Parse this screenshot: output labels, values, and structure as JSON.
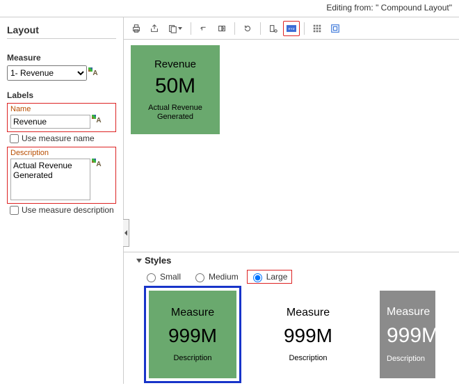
{
  "header": {
    "editing_from_label": "Editing from:",
    "editing_from_value": "\" Compound Layout\""
  },
  "sidebar": {
    "title": "Layout",
    "measure_label": "Measure",
    "measure_value": "1- Revenue",
    "labels_label": "Labels",
    "name_box": {
      "title": "Name",
      "value": "Revenue"
    },
    "use_measure_name": "Use measure name",
    "description_box": {
      "title": "Description",
      "value": "Actual Revenue Generated"
    },
    "use_measure_description": "Use measure description"
  },
  "toolbar": {
    "print": "print",
    "export": "export",
    "clipboard": "clipboard",
    "undo": "undo",
    "redo": "redo",
    "refresh": "refresh",
    "props": "properties",
    "xyz": "xyz",
    "grid": "grid",
    "container": "container"
  },
  "preview_tile": {
    "title": "Revenue",
    "value": "50M",
    "desc": "Actual Revenue Generated"
  },
  "styles": {
    "header": "Styles",
    "options": {
      "small": "Small",
      "medium": "Medium",
      "large": "Large"
    },
    "selected": "large",
    "sample": {
      "title": "Measure",
      "value": "999M",
      "desc": "Description"
    }
  }
}
